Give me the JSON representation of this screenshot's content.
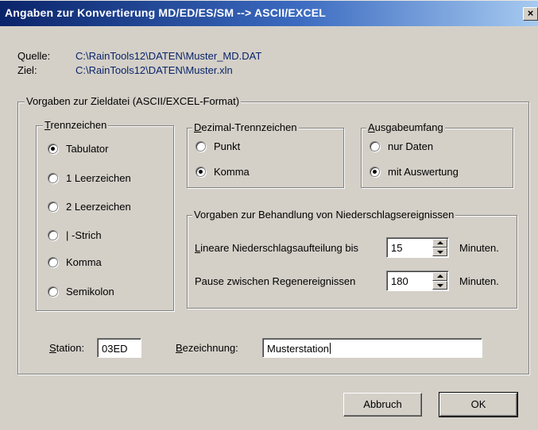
{
  "window": {
    "title": "Angaben zur Konvertierung MD/ED/ES/SM --> ASCII/EXCEL",
    "close_label": "×"
  },
  "info": {
    "source_label": "Quelle:",
    "source_value": "C:\\RainTools12\\DATEN\\Muster_MD.DAT",
    "target_label": "Ziel:",
    "target_value": "C:\\RainTools12\\DATEN\\Muster.xln"
  },
  "main_group": {
    "legend": "Vorgaben zur Zieldatei (ASCII/EXCEL-Format)"
  },
  "separator_group": {
    "legend_underlined": "T",
    "legend_rest": "rennzeichen",
    "options": [
      {
        "label": "Tabulator",
        "checked": true
      },
      {
        "label": "1 Leerzeichen",
        "checked": false
      },
      {
        "label": "2 Leerzeichen",
        "checked": false
      },
      {
        "label": "| -Strich",
        "checked": false
      },
      {
        "label": "Komma",
        "checked": false
      },
      {
        "label": "Semikolon",
        "checked": false
      }
    ]
  },
  "decimal_group": {
    "legend_underlined": "D",
    "legend_rest": "ezimal-Trennzeichen",
    "options": [
      {
        "label": "Punkt",
        "checked": false
      },
      {
        "label": "Komma",
        "checked": true
      }
    ]
  },
  "output_group": {
    "legend_underlined": "A",
    "legend_rest": "usgabeumfang",
    "options": [
      {
        "label": "nur Daten",
        "checked": false
      },
      {
        "label": "mit Auswertung",
        "checked": true
      }
    ]
  },
  "precip_group": {
    "legend": "Vorgaben zur Behandlung von Niederschlagsereignissen",
    "linear_label_underlined": "L",
    "linear_label_rest": "ineare Niederschlagsaufteilung bis",
    "linear_value": "15",
    "linear_unit": "Minuten.",
    "pause_label": "Pause zwischen Regenereignissen",
    "pause_value": "180",
    "pause_unit": "Minuten."
  },
  "station": {
    "label_underlined": "S",
    "label_rest": "tation:",
    "value": "03ED",
    "name_label_underlined": "B",
    "name_label_rest": "ezeichnung:",
    "name_value": "Musterstation"
  },
  "buttons": {
    "cancel": "Abbruch",
    "ok": "OK"
  }
}
